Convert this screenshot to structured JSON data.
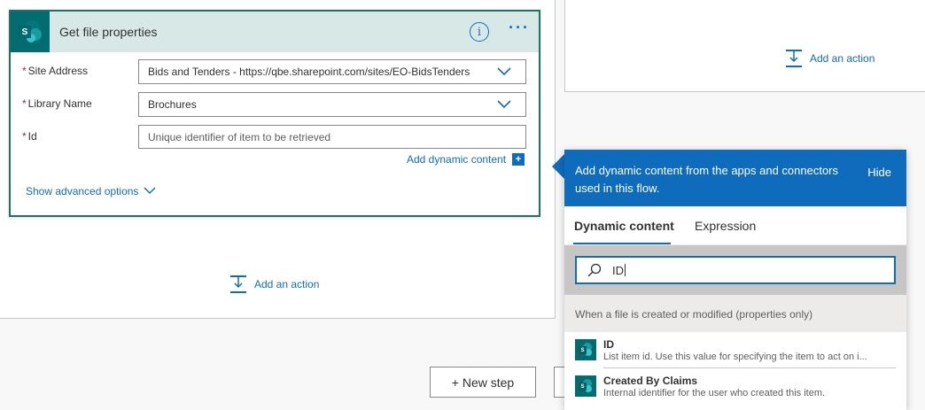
{
  "card": {
    "title": "Get file properties",
    "info_glyph": "i",
    "more_glyph": "···",
    "icon": "sharepoint-icon",
    "fields": [
      {
        "label": "Site Address",
        "required": true,
        "value": "Bids and Tenders - https://qbe.sharepoint.com/sites/EO-BidsTenders",
        "placeholder": ""
      },
      {
        "label": "Library Name",
        "required": true,
        "value": "Brochures",
        "placeholder": ""
      },
      {
        "label": "Id",
        "required": true,
        "value": "",
        "placeholder": "Unique identifier of item to be retrieved"
      }
    ],
    "add_dynamic_content": "Add dynamic content",
    "add_dynamic_icon": "+",
    "advanced_options": "Show advanced options"
  },
  "add_action_label": "Add an action",
  "new_step_label": "+ New step",
  "dynamic_panel": {
    "header_text": "Add dynamic content from the apps and connectors used in this flow.",
    "hide_label": "Hide",
    "tabs": [
      "Dynamic content",
      "Expression"
    ],
    "active_tab": "Dynamic content",
    "search_value": "ID",
    "group_title": "When a file is created or modified (properties only)",
    "items": [
      {
        "name": "ID",
        "description": "List item id. Use this value for specifying the item to act on i..."
      },
      {
        "name": "Created By Claims",
        "description": "Internal identifier for the user who created this item."
      }
    ]
  },
  "colors": {
    "accent": "#0f6cbd",
    "sharepoint": "#036c70",
    "card_border": "#1f6f63",
    "card_header": "#d8e8e6"
  }
}
